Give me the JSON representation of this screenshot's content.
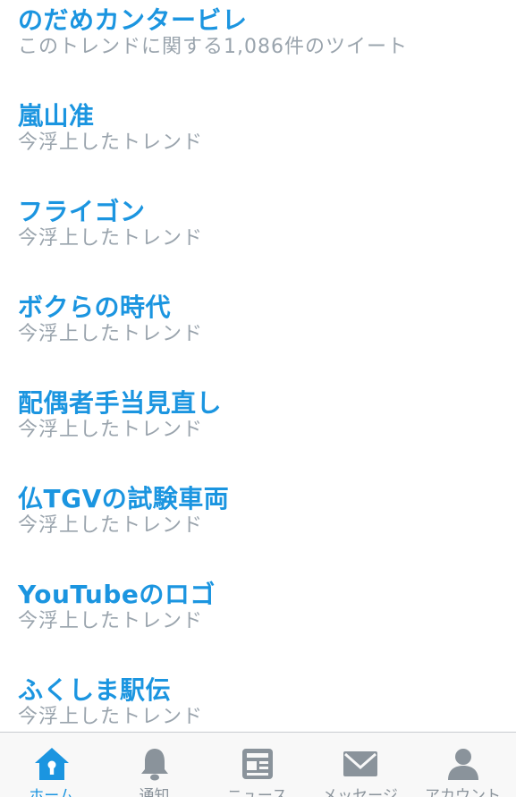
{
  "trends": [
    {
      "title": "のだめカンタービレ",
      "subtitle": "このトレンドに関する1,086件のツイート"
    },
    {
      "title": "嵐山准",
      "subtitle": "今浮上したトレンド"
    },
    {
      "title": "フライゴン",
      "subtitle": "今浮上したトレンド"
    },
    {
      "title": "ボクらの時代",
      "subtitle": "今浮上したトレンド"
    },
    {
      "title": "配偶者手当見直し",
      "subtitle": "今浮上したトレンド"
    },
    {
      "title": "仏TGVの試験車両",
      "subtitle": "今浮上したトレンド"
    },
    {
      "title": "YouTubeのロゴ",
      "subtitle": "今浮上したトレンド"
    },
    {
      "title": "ふくしま駅伝",
      "subtitle": "今浮上したトレンド"
    }
  ],
  "tabbar": {
    "tabs": [
      {
        "label": "ホーム",
        "icon": "home-icon",
        "active": true
      },
      {
        "label": "通知",
        "icon": "bell-icon",
        "active": false
      },
      {
        "label": "ニュース",
        "icon": "news-icon",
        "active": false
      },
      {
        "label": "メッセージ",
        "icon": "envelope-icon",
        "active": false
      },
      {
        "label": "アカウント",
        "icon": "person-icon",
        "active": false
      }
    ]
  },
  "colors": {
    "accent": "#1b95e0",
    "inactive_icon": "#8a939b",
    "subtitle": "#9aa4ad",
    "tabbar_bg": "#f8f8f8"
  }
}
